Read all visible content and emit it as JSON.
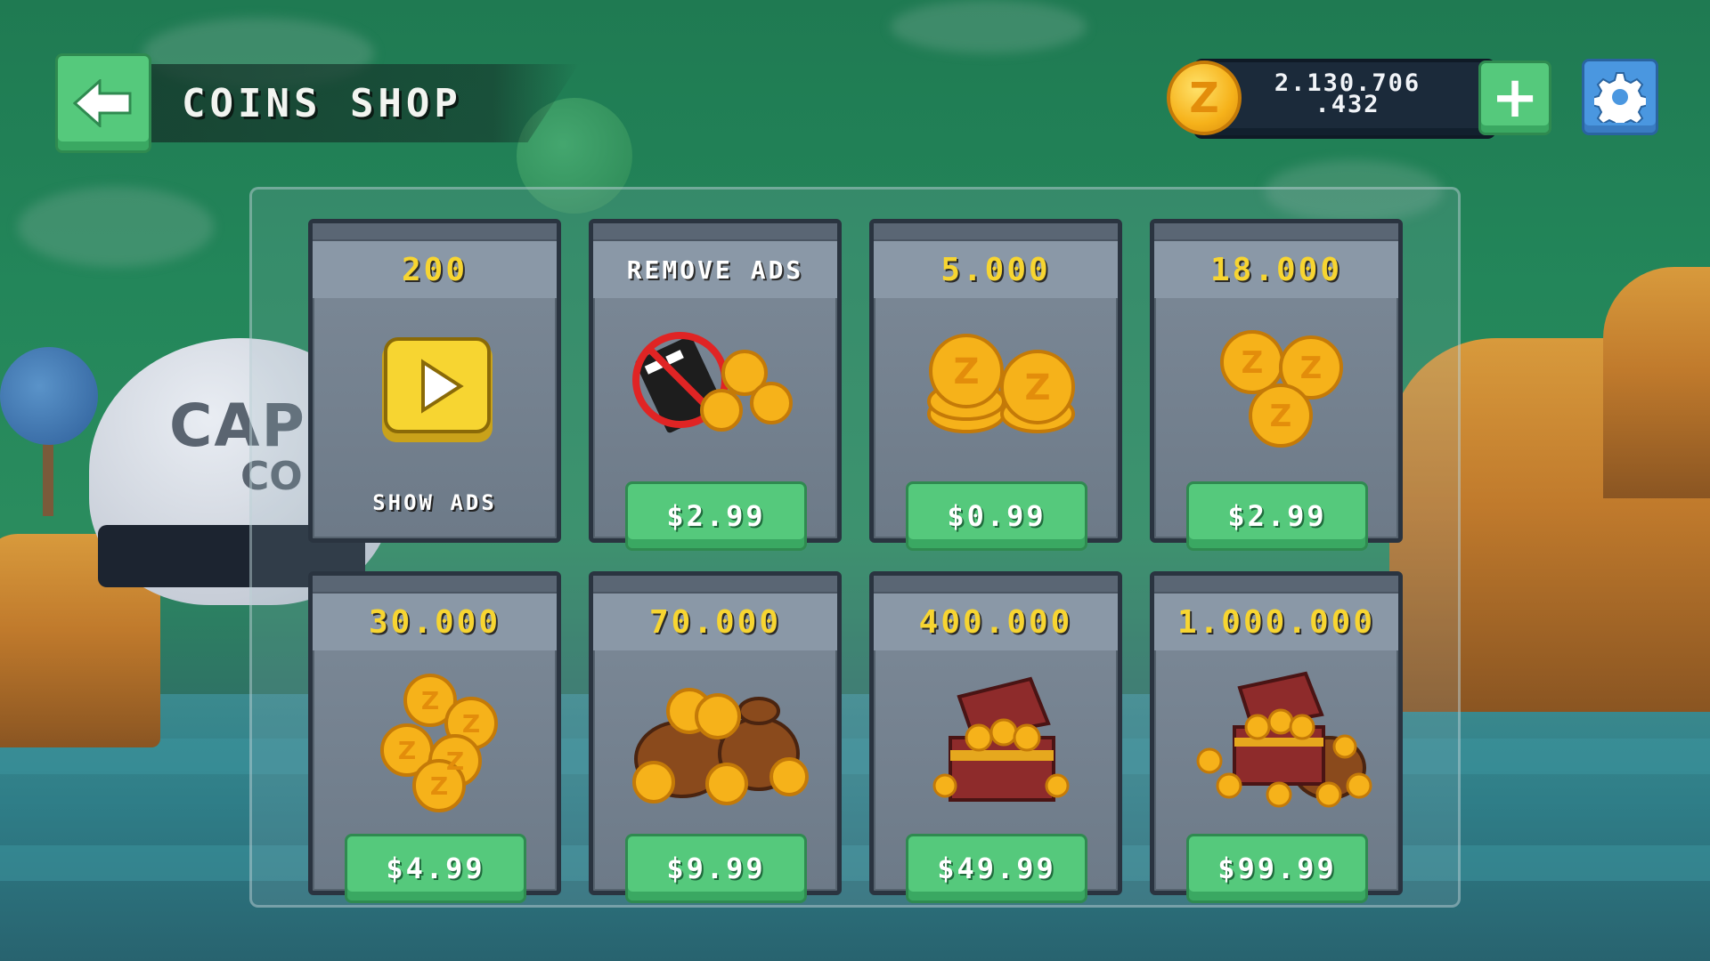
{
  "header": {
    "title": "COINS SHOP",
    "back_icon": "arrow-left-icon",
    "balance_line1": "2.130.706",
    "balance_line2": ".432",
    "coin_symbol": "Z",
    "add_coins_icon": "plus-icon",
    "settings_icon": "gear-icon"
  },
  "background": {
    "sign_line1": "CAPSU",
    "sign_line2": "CO"
  },
  "shop": {
    "items": [
      {
        "amount": "200",
        "label": "SHOW ADS",
        "icon": "play-video-icon"
      },
      {
        "amount": "REMOVE ADS",
        "price": "$2.99",
        "icon": "no-ads-icon"
      },
      {
        "amount": "5.000",
        "price": "$0.99",
        "icon": "coin-stacks-icon"
      },
      {
        "amount": "18.000",
        "price": "$2.99",
        "icon": "coin-pile-icon"
      },
      {
        "amount": "30.000",
        "price": "$4.99",
        "icon": "coin-pile-large-icon"
      },
      {
        "amount": "70.000",
        "price": "$9.99",
        "icon": "coin-bags-icon"
      },
      {
        "amount": "400.000",
        "price": "$49.99",
        "icon": "treasure-chest-icon"
      },
      {
        "amount": "1.000.000",
        "price": "$99.99",
        "icon": "treasure-hoard-icon"
      }
    ]
  },
  "colors": {
    "accent_green": "#55c97c",
    "settings_blue": "#4a97e0",
    "amount_yellow": "#f7d531",
    "coin_gold": "#f6b21a"
  }
}
